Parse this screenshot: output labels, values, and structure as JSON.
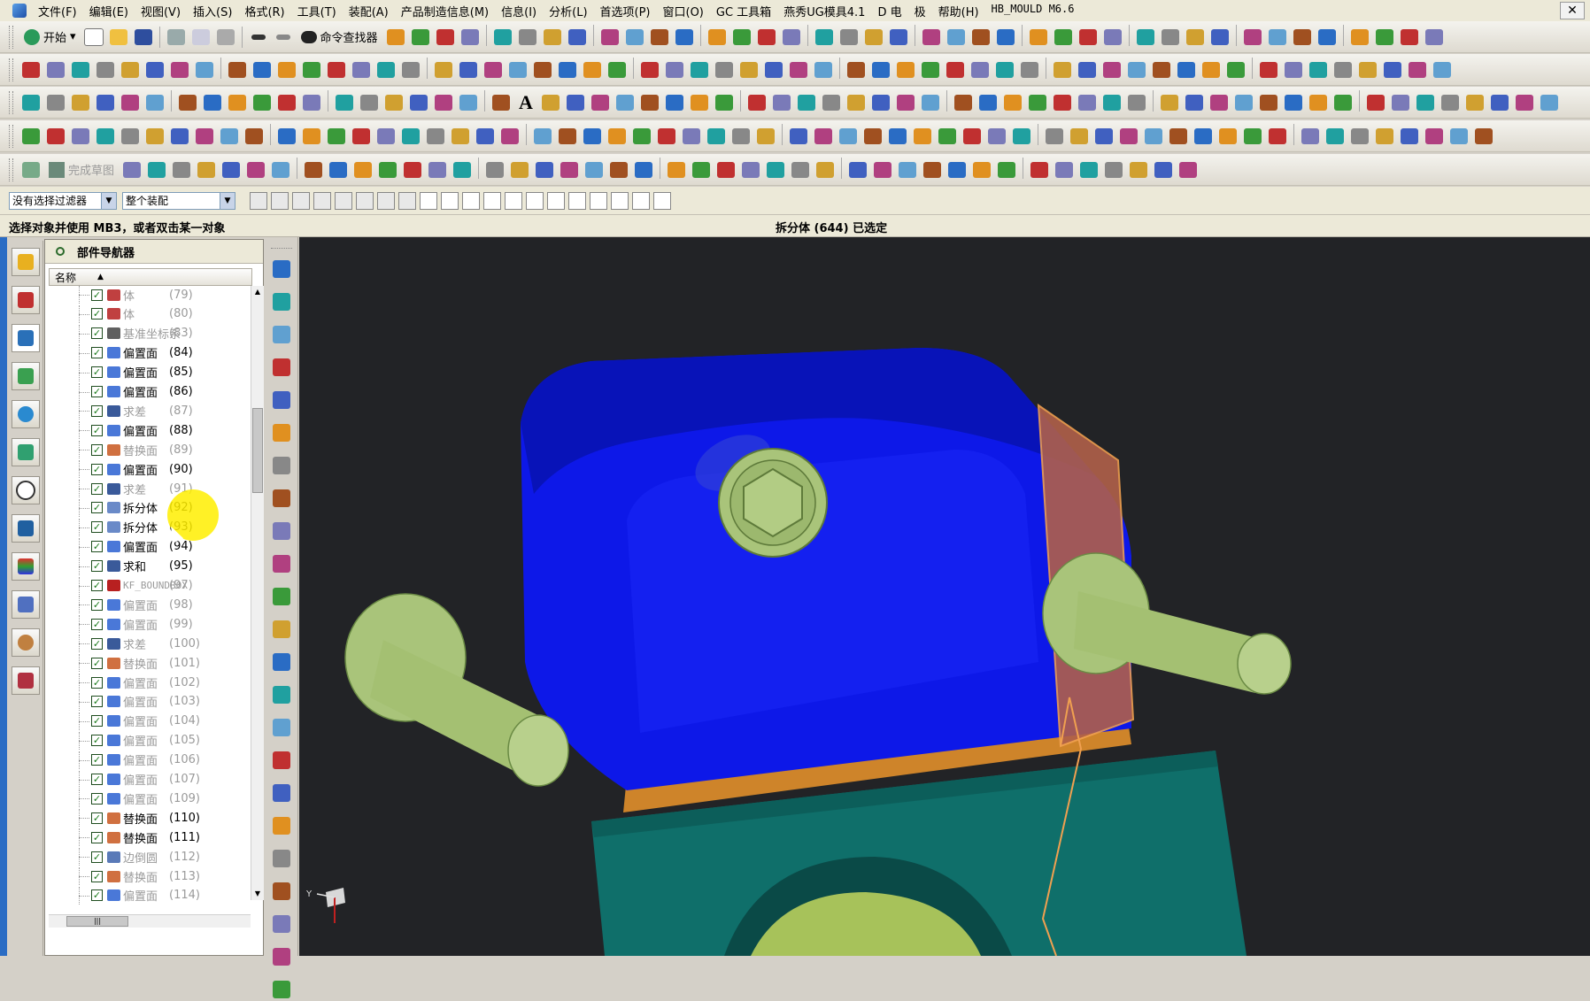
{
  "menubar": {
    "items": [
      "文件(F)",
      "编辑(E)",
      "视图(V)",
      "插入(S)",
      "格式(R)",
      "工具(T)",
      "装配(A)",
      "产品制造信息(M)",
      "信息(I)",
      "分析(L)",
      "首选项(P)",
      "窗口(O)",
      "GC 工具箱",
      "燕秀UG模具4.1",
      "D 电",
      "极",
      "帮助(H)",
      "HB_MOULD M6.6"
    ],
    "close_glyph": "✕"
  },
  "toolbar": {
    "start_label": "开始",
    "finder_label": "命令查找器",
    "sketch_finish_label": "完成草图",
    "text_tool_glyph": "A"
  },
  "filterbar": {
    "filter_value": "没有选择过滤器",
    "scope_value": "整个装配"
  },
  "status": {
    "prompt": "选择对象并使用 MB3，或者双击某一对象",
    "selection": "拆分体 (644) 已选定"
  },
  "navigator": {
    "title": "部件导航器",
    "column_header": "名称",
    "sort_glyph": "▲",
    "rows": [
      {
        "label": "体",
        "num": "(79)",
        "dim": true,
        "icon": "body"
      },
      {
        "label": "体",
        "num": "(80)",
        "dim": true,
        "icon": "body"
      },
      {
        "label": "基准坐标系",
        "num": "(83)",
        "dim": true,
        "icon": "csys"
      },
      {
        "label": "偏置面",
        "num": "(84)",
        "dim": false,
        "icon": "offset"
      },
      {
        "label": "偏置面",
        "num": "(85)",
        "dim": false,
        "icon": "offset"
      },
      {
        "label": "偏置面",
        "num": "(86)",
        "dim": false,
        "icon": "offset"
      },
      {
        "label": "求差",
        "num": "(87)",
        "dim": true,
        "icon": "subtract"
      },
      {
        "label": "偏置面",
        "num": "(88)",
        "dim": false,
        "icon": "offset"
      },
      {
        "label": "替换面",
        "num": "(89)",
        "dim": true,
        "icon": "replace"
      },
      {
        "label": "偏置面",
        "num": "(90)",
        "dim": false,
        "icon": "offset"
      },
      {
        "label": "求差",
        "num": "(91)",
        "dim": true,
        "icon": "subtract"
      },
      {
        "label": "拆分体",
        "num": "(92)",
        "dim": false,
        "icon": "split"
      },
      {
        "label": "拆分体",
        "num": "(93)",
        "dim": false,
        "icon": "split"
      },
      {
        "label": "偏置面",
        "num": "(94)",
        "dim": false,
        "icon": "offset"
      },
      {
        "label": "求和",
        "num": "(95)",
        "dim": false,
        "icon": "subtract"
      },
      {
        "label": "KF_BOUNDBOX",
        "num": "(97)",
        "dim": true,
        "icon": "kf"
      },
      {
        "label": "偏置面",
        "num": "(98)",
        "dim": true,
        "icon": "offset"
      },
      {
        "label": "偏置面",
        "num": "(99)",
        "dim": true,
        "icon": "offset"
      },
      {
        "label": "求差",
        "num": "(100)",
        "dim": true,
        "icon": "subtract"
      },
      {
        "label": "替换面",
        "num": "(101)",
        "dim": true,
        "icon": "replace"
      },
      {
        "label": "偏置面",
        "num": "(102)",
        "dim": true,
        "icon": "offset"
      },
      {
        "label": "偏置面",
        "num": "(103)",
        "dim": true,
        "icon": "offset"
      },
      {
        "label": "偏置面",
        "num": "(104)",
        "dim": true,
        "icon": "offset"
      },
      {
        "label": "偏置面",
        "num": "(105)",
        "dim": true,
        "icon": "offset"
      },
      {
        "label": "偏置面",
        "num": "(106)",
        "dim": true,
        "icon": "offset"
      },
      {
        "label": "偏置面",
        "num": "(107)",
        "dim": true,
        "icon": "offset"
      },
      {
        "label": "偏置面",
        "num": "(109)",
        "dim": true,
        "icon": "offset"
      },
      {
        "label": "替换面",
        "num": "(110)",
        "dim": false,
        "icon": "replace"
      },
      {
        "label": "替换面",
        "num": "(111)",
        "dim": false,
        "icon": "replace"
      },
      {
        "label": "边倒圆",
        "num": "(112)",
        "dim": true,
        "icon": "blend"
      },
      {
        "label": "替换面",
        "num": "(113)",
        "dim": true,
        "icon": "replace"
      },
      {
        "label": "偏置面",
        "num": "(114)",
        "dim": true,
        "icon": "offset"
      }
    ]
  },
  "viewport": {
    "triad_label": "Y",
    "colors": {
      "block": "#0d18e8",
      "split_face": "#f0a050",
      "pins": "#a9c47a",
      "base": "#0f6f6a"
    }
  }
}
